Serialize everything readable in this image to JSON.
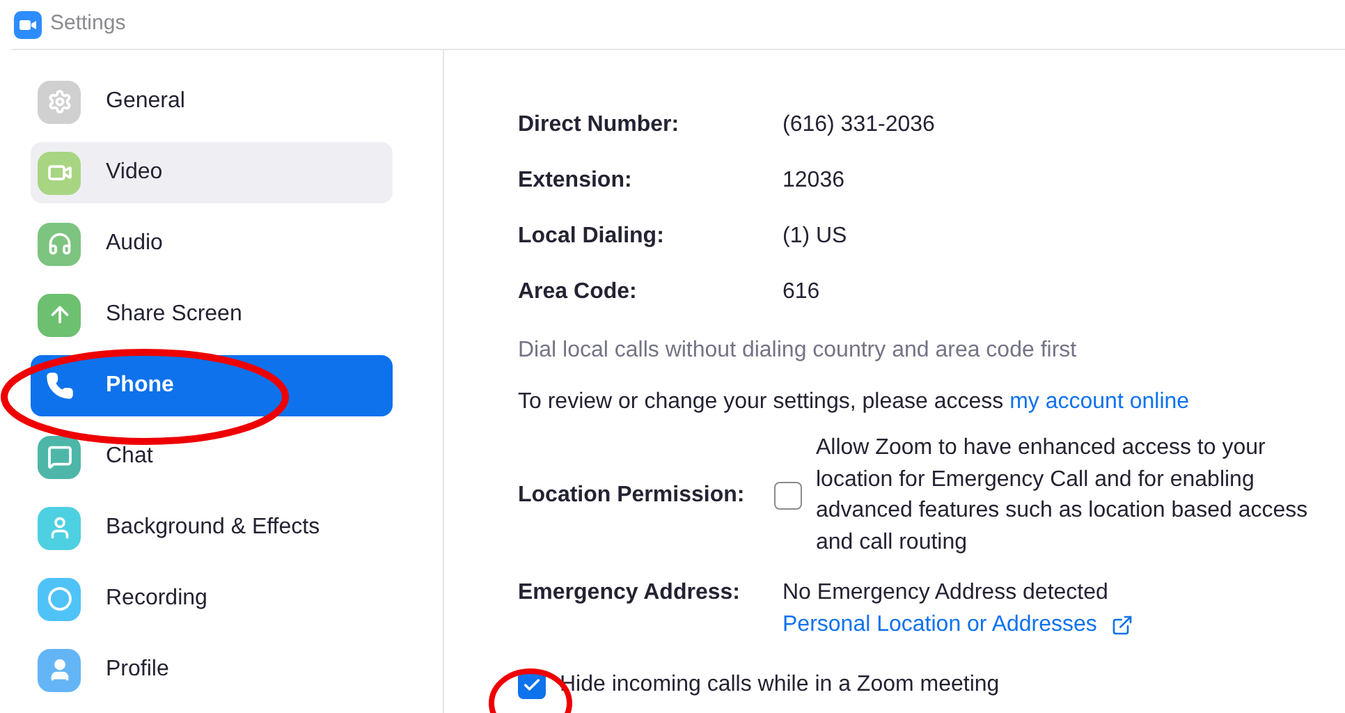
{
  "window": {
    "title": "Settings"
  },
  "sidebar": {
    "items": [
      {
        "label": "General",
        "selected": false,
        "hovered": false,
        "color": "#d0d0d0"
      },
      {
        "label": "Video",
        "selected": false,
        "hovered": true,
        "color": "#a8d582"
      },
      {
        "label": "Audio",
        "selected": false,
        "hovered": false,
        "color": "#7cc47f"
      },
      {
        "label": "Share Screen",
        "selected": false,
        "hovered": false,
        "color": "#6cc070"
      },
      {
        "label": "Phone",
        "selected": true,
        "hovered": false,
        "color": "#0e72ed"
      },
      {
        "label": "Chat",
        "selected": false,
        "hovered": false,
        "color": "#4db6a8"
      },
      {
        "label": "Background & Effects",
        "selected": false,
        "hovered": false,
        "color": "#4dd0e1"
      },
      {
        "label": "Recording",
        "selected": false,
        "hovered": false,
        "color": "#4fc3f7"
      },
      {
        "label": "Profile",
        "selected": false,
        "hovered": false,
        "color": "#64b5f6"
      }
    ]
  },
  "phone": {
    "fields": [
      {
        "label": "Direct Number:",
        "value": "(616) 331-2036"
      },
      {
        "label": "Extension:",
        "value": "12036"
      },
      {
        "label": "Local Dialing:",
        "value": "(1) US"
      },
      {
        "label": "Area Code:",
        "value": "616"
      }
    ],
    "dial_note": "Dial local calls without dialing country and area code first",
    "review_text": "To review or change your settings, please access",
    "review_link": "my account online",
    "location_permission": {
      "label": "Location Permission:",
      "checked": false,
      "text": "Allow Zoom to have enhanced access to your location for Emergency Call and for enabling advanced features such as location based access and call routing"
    },
    "emergency_address": {
      "label": "Emergency Address:",
      "value": "No Emergency Address detected",
      "link": "Personal Location or Addresses"
    },
    "hide_calls": {
      "label": "Hide incoming calls while in a Zoom meeting",
      "checked": true
    }
  }
}
